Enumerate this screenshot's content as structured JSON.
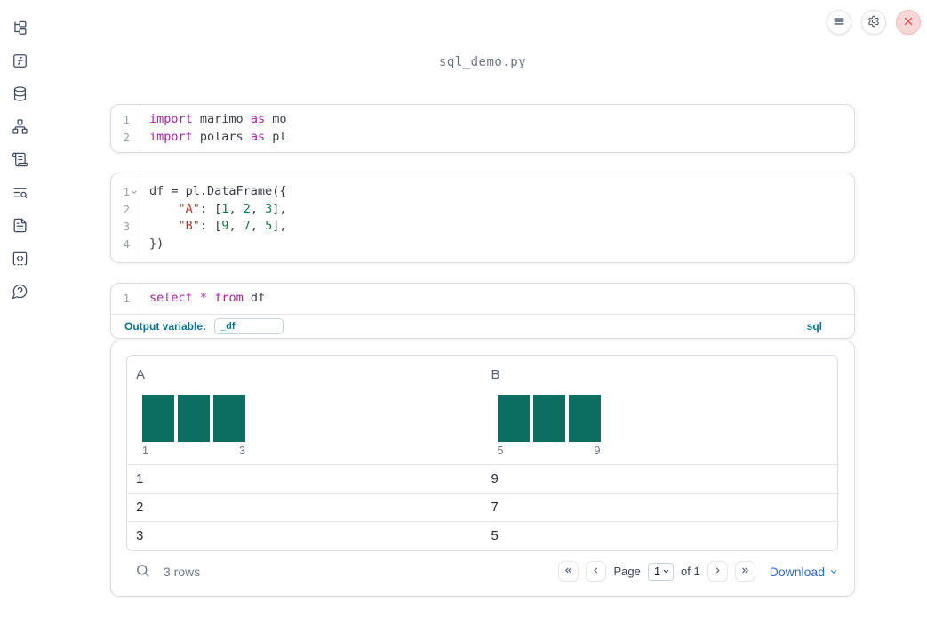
{
  "window": {
    "title": "sql_demo.py"
  },
  "topbar": {
    "buttons": [
      {
        "name": "menu-button",
        "icon": "hamburger-icon"
      },
      {
        "name": "settings-button",
        "icon": "gear-icon"
      },
      {
        "name": "shutdown-button",
        "icon": "close-icon"
      }
    ]
  },
  "sidebar": {
    "items": [
      {
        "name": "file-explorer-icon"
      },
      {
        "name": "variables-icon"
      },
      {
        "name": "data-sources-icon"
      },
      {
        "name": "dependency-graph-icon"
      },
      {
        "name": "scratchpad-icon"
      },
      {
        "name": "logs-search-icon"
      },
      {
        "name": "documentation-icon"
      },
      {
        "name": "snippets-icon"
      },
      {
        "name": "help-icon"
      }
    ]
  },
  "cells": [
    {
      "id": "imports",
      "lines": [
        {
          "n": "1",
          "tokens": [
            [
              "kw",
              "import"
            ],
            [
              "pl",
              " marimo "
            ],
            [
              "kw",
              "as"
            ],
            [
              "pl",
              " mo"
            ]
          ]
        },
        {
          "n": "2",
          "tokens": [
            [
              "kw",
              "import"
            ],
            [
              "pl",
              " polars "
            ],
            [
              "kw",
              "as"
            ],
            [
              "pl",
              " pl"
            ]
          ]
        }
      ]
    },
    {
      "id": "dataframe",
      "lines": [
        {
          "n": "1",
          "fold": true,
          "tokens": [
            [
              "pl",
              "df = pl.DataFrame({"
            ]
          ]
        },
        {
          "n": "2",
          "tokens": [
            [
              "pl",
              "    "
            ],
            [
              "str",
              "\"A\""
            ],
            [
              "pl",
              ": ["
            ],
            [
              "num",
              "1"
            ],
            [
              "pl",
              ", "
            ],
            [
              "num",
              "2"
            ],
            [
              "pl",
              ", "
            ],
            [
              "num",
              "3"
            ],
            [
              "pl",
              "],"
            ]
          ]
        },
        {
          "n": "3",
          "tokens": [
            [
              "pl",
              "    "
            ],
            [
              "str",
              "\"B\""
            ],
            [
              "pl",
              ": ["
            ],
            [
              "num",
              "9"
            ],
            [
              "pl",
              ", "
            ],
            [
              "num",
              "7"
            ],
            [
              "pl",
              ", "
            ],
            [
              "num",
              "5"
            ],
            [
              "pl",
              "],"
            ]
          ]
        },
        {
          "n": "4",
          "tokens": [
            [
              "pl",
              "})"
            ]
          ]
        }
      ]
    },
    {
      "id": "sql",
      "lines": [
        {
          "n": "1",
          "tokens": [
            [
              "kw",
              "select"
            ],
            [
              "pl",
              " "
            ],
            [
              "kw",
              "*"
            ],
            [
              "pl",
              " "
            ],
            [
              "kw",
              "from"
            ],
            [
              "pl",
              " df"
            ]
          ]
        }
      ]
    }
  ],
  "sql_footer": {
    "output_variable_label": "Output variable:",
    "output_variable_value": "_df",
    "language_tag": "sql"
  },
  "table": {
    "columns": [
      {
        "label": "A",
        "histogram": {
          "bars": [
            1,
            1,
            1
          ],
          "min_label": "1",
          "max_label": "3"
        }
      },
      {
        "label": "B",
        "histogram": {
          "bars": [
            1,
            1,
            1
          ],
          "min_label": "5",
          "max_label": "9"
        }
      }
    ],
    "rows": [
      [
        "1",
        "9"
      ],
      [
        "2",
        "7"
      ],
      [
        "3",
        "5"
      ]
    ],
    "footer": {
      "row_count": "3 rows",
      "page_label": "Page",
      "page_value": "1",
      "page_of": "of 1",
      "download_label": "Download"
    }
  },
  "colors": {
    "keyword_purple": "#a626a4",
    "string_red": "#b03a30",
    "number_green": "#0e7a44",
    "histogram_teal": "#0c6e60",
    "sql_label_blue": "#0c7292",
    "link_blue": "#2a6bdf",
    "close_red": "#da5252"
  }
}
